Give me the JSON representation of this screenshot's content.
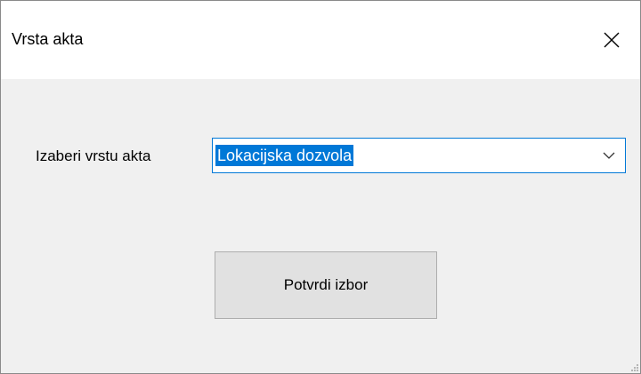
{
  "window": {
    "title": "Vrsta akta"
  },
  "form": {
    "label": "Izaberi vrstu akta",
    "combo_value": "Lokacijska dozvola",
    "confirm_label": "Potvrdi izbor"
  },
  "icons": {
    "close": "close-icon",
    "dropdown": "chevron-down-icon",
    "resize": "resize-grip-icon"
  },
  "colors": {
    "selection": "#0078d7",
    "button_face": "#e1e1e1",
    "dialog_background": "#f0f0f0"
  }
}
